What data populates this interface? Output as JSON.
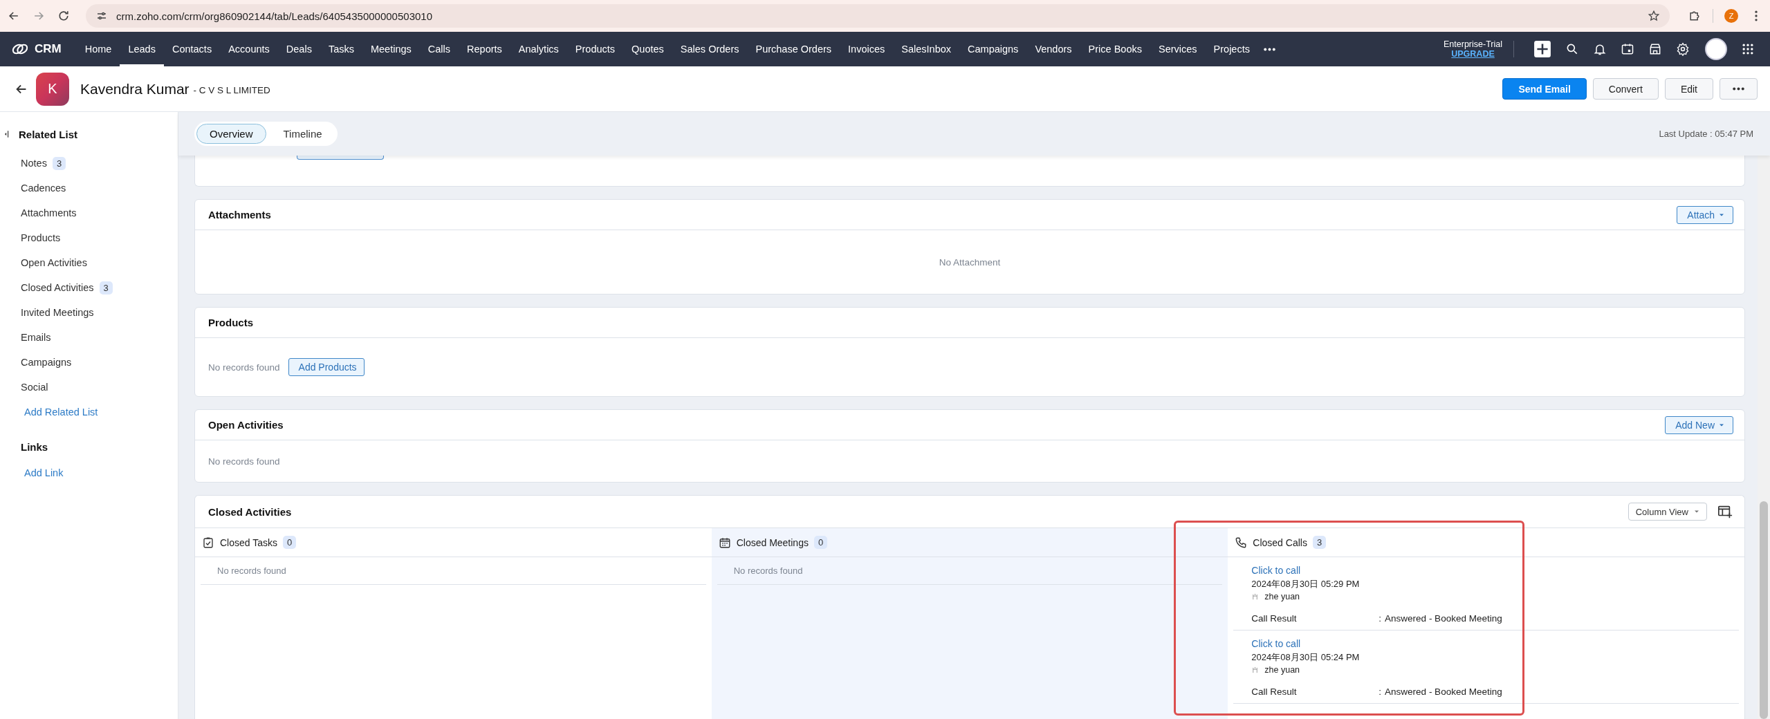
{
  "browser": {
    "url": "crm.zoho.com/crm/org860902144/tab/Leads/6405435000000503010",
    "profile_initial": "Z"
  },
  "nav": {
    "logo": "CRM",
    "items": [
      {
        "label": "Home",
        "selected": false
      },
      {
        "label": "Leads",
        "selected": true
      },
      {
        "label": "Contacts",
        "selected": false
      },
      {
        "label": "Accounts",
        "selected": false
      },
      {
        "label": "Deals",
        "selected": false
      },
      {
        "label": "Tasks",
        "selected": false
      },
      {
        "label": "Meetings",
        "selected": false
      },
      {
        "label": "Calls",
        "selected": false
      },
      {
        "label": "Reports",
        "selected": false
      },
      {
        "label": "Analytics",
        "selected": false
      },
      {
        "label": "Products",
        "selected": false
      },
      {
        "label": "Quotes",
        "selected": false
      },
      {
        "label": "Sales Orders",
        "selected": false
      },
      {
        "label": "Purchase Orders",
        "selected": false
      },
      {
        "label": "Invoices",
        "selected": false
      },
      {
        "label": "SalesInbox",
        "selected": false
      },
      {
        "label": "Campaigns",
        "selected": false
      },
      {
        "label": "Vendors",
        "selected": false
      },
      {
        "label": "Price Books",
        "selected": false
      },
      {
        "label": "Services",
        "selected": false
      },
      {
        "label": "Projects",
        "selected": false
      }
    ],
    "plan": "Enterprise-Trial",
    "upgrade": "UPGRADE"
  },
  "record": {
    "avatar_initial": "K",
    "name": "Kavendra Kumar",
    "company": "- C V S L LIMITED",
    "buttons": [
      {
        "label": "Send Email",
        "kind": "primary"
      },
      {
        "label": "Convert",
        "kind": "default"
      },
      {
        "label": "Edit",
        "kind": "default"
      }
    ]
  },
  "sidebar": {
    "title": "Related List",
    "items": [
      {
        "label": "Notes",
        "count": "3"
      },
      {
        "label": "Cadences"
      },
      {
        "label": "Attachments"
      },
      {
        "label": "Products"
      },
      {
        "label": "Open Activities"
      },
      {
        "label": "Closed Activities",
        "count": "3"
      },
      {
        "label": "Invited Meetings"
      },
      {
        "label": "Emails"
      },
      {
        "label": "Campaigns"
      },
      {
        "label": "Social"
      }
    ],
    "add_related": "Add Related List",
    "links_title": "Links",
    "add_link": "Add Link"
  },
  "view_tabs": [
    {
      "label": "Overview",
      "selected": true
    },
    {
      "label": "Timeline",
      "selected": false
    }
  ],
  "last_update": "Last Update : 05:47 PM",
  "sections": [
    {
      "title": "Attachments",
      "kind": "centered",
      "action": "Attach",
      "empty": "No Attachment"
    },
    {
      "title": "Products",
      "kind": "left",
      "empty": "No records found",
      "empty_action": "Add Products"
    },
    {
      "title": "Open Activities",
      "kind": "left",
      "action": "Add New",
      "empty": "No records found"
    }
  ],
  "closed_activities": {
    "title": "Closed Activities",
    "view_select": "Column View",
    "columns": [
      {
        "kind": "tasks",
        "title": "Closed Tasks",
        "count": "0",
        "highlighted": false,
        "empty": "No records found"
      },
      {
        "kind": "meetings",
        "title": "Closed Meetings",
        "count": "0",
        "highlighted": true,
        "empty": "No records found"
      },
      {
        "kind": "calls",
        "title": "Closed Calls",
        "count": "3",
        "highlighted": false,
        "records": [
          {
            "link": "Click to call",
            "datetime": "2024年08月30日 05:29 PM",
            "owner": "zhe yuan",
            "field_label": "Call Result",
            "separator": ":",
            "field_value": "Answered - Booked Meeting"
          },
          {
            "link": "Click to call",
            "datetime": "2024年08月30日 05:24 PM",
            "owner": "zhe yuan",
            "field_label": "Call Result",
            "separator": ":",
            "field_value": "Answered - Booked Meeting"
          }
        ]
      }
    ]
  }
}
